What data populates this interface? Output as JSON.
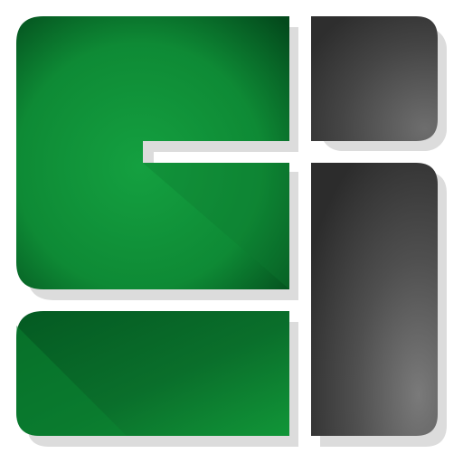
{
  "logo": {
    "name": "GI logo mark",
    "colors": {
      "green_dark": "#034a1c",
      "green_mid": "#0c7a2f",
      "green_light": "#14a040",
      "gray_dark": "#2f2f2f",
      "gray_mid": "#4a4a4a",
      "gray_light": "#777777",
      "shadow": "#d9d9d9",
      "background": "#ffffff"
    }
  }
}
